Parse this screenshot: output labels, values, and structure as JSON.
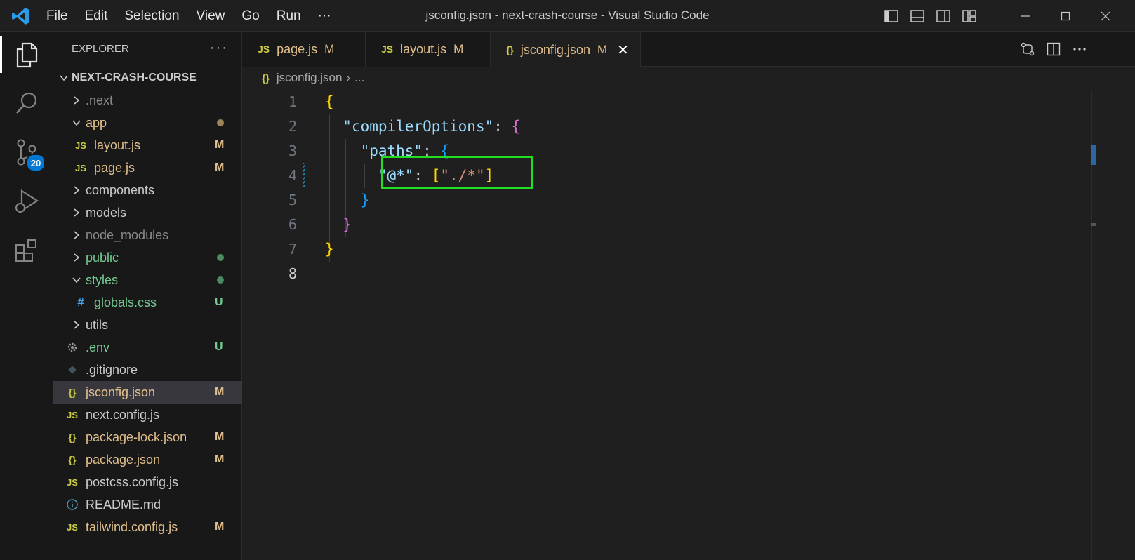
{
  "window": {
    "title": "jsconfig.json - next-crash-course - Visual Studio Code"
  },
  "menu": [
    "File",
    "Edit",
    "Selection",
    "View",
    "Go",
    "Run",
    "···"
  ],
  "activity": {
    "source_control_badge": "20"
  },
  "sidebar": {
    "title": "EXPLORER",
    "more": "···",
    "root": "NEXT-CRASH-COURSE",
    "items": [
      {
        "name": ".next",
        "kind": "folder",
        "open": false,
        "depth": 0,
        "color": "dim",
        "status": ""
      },
      {
        "name": "app",
        "kind": "folder",
        "open": true,
        "depth": 0,
        "color": "mod",
        "status": "dot"
      },
      {
        "name": "layout.js",
        "kind": "js",
        "depth": 1,
        "color": "mod",
        "status": "M"
      },
      {
        "name": "page.js",
        "kind": "js",
        "depth": 1,
        "color": "mod",
        "status": "M"
      },
      {
        "name": "components",
        "kind": "folder",
        "open": false,
        "depth": 0,
        "color": "def",
        "status": ""
      },
      {
        "name": "models",
        "kind": "folder",
        "open": false,
        "depth": 0,
        "color": "def",
        "status": ""
      },
      {
        "name": "node_modules",
        "kind": "folder",
        "open": false,
        "depth": 0,
        "color": "dim",
        "status": ""
      },
      {
        "name": "public",
        "kind": "folder",
        "open": false,
        "depth": 0,
        "color": "unt",
        "status": "dot"
      },
      {
        "name": "styles",
        "kind": "folder",
        "open": true,
        "depth": 0,
        "color": "unt",
        "status": "dot"
      },
      {
        "name": "globals.css",
        "kind": "css",
        "depth": 1,
        "color": "unt",
        "status": "U"
      },
      {
        "name": "utils",
        "kind": "folder",
        "open": false,
        "depth": 0,
        "color": "def",
        "status": ""
      },
      {
        "name": ".env",
        "kind": "gear",
        "depth": 0,
        "color": "unt",
        "status": "U"
      },
      {
        "name": ".gitignore",
        "kind": "git",
        "depth": 0,
        "color": "def",
        "status": ""
      },
      {
        "name": "jsconfig.json",
        "kind": "json",
        "depth": 0,
        "color": "mod",
        "status": "M",
        "selected": true
      },
      {
        "name": "next.config.js",
        "kind": "js",
        "depth": 0,
        "color": "def",
        "status": ""
      },
      {
        "name": "package-lock.json",
        "kind": "json",
        "depth": 0,
        "color": "mod",
        "status": "M"
      },
      {
        "name": "package.json",
        "kind": "json",
        "depth": 0,
        "color": "mod",
        "status": "M"
      },
      {
        "name": "postcss.config.js",
        "kind": "js",
        "depth": 0,
        "color": "def",
        "status": ""
      },
      {
        "name": "README.md",
        "kind": "info",
        "depth": 0,
        "color": "def",
        "status": ""
      },
      {
        "name": "tailwind.config.js",
        "kind": "js",
        "depth": 0,
        "color": "mod",
        "status": "M"
      }
    ]
  },
  "tabs": [
    {
      "icon": "JS",
      "label": "page.js",
      "mod": "M",
      "active": false
    },
    {
      "icon": "JS",
      "label": "layout.js",
      "mod": "M",
      "active": false
    },
    {
      "icon": "{}",
      "label": "jsconfig.json",
      "mod": "M",
      "active": true,
      "close": "✕"
    }
  ],
  "breadcrumb": {
    "icon": "{}",
    "file": "jsconfig.json",
    "sep": "›",
    "more": "..."
  },
  "editor": {
    "line_numbers": [
      "1",
      "2",
      "3",
      "4",
      "5",
      "6",
      "7",
      "8"
    ],
    "current_line": "8",
    "code": {
      "l1_open": "{",
      "l2_key": "\"compilerOptions\"",
      "l2_colon": ": ",
      "l2_open": "{",
      "l3_key": "\"paths\"",
      "l3_colon": ": ",
      "l3_open": "{",
      "l4_key": "\"@*\"",
      "l4_colon": ": ",
      "l4_open": "[",
      "l4_value": "\"./*\"",
      "l4_close": "]",
      "l5_close": "}",
      "l6_close": "}",
      "l7_close": "}"
    },
    "highlight_color": "#22dd22"
  }
}
